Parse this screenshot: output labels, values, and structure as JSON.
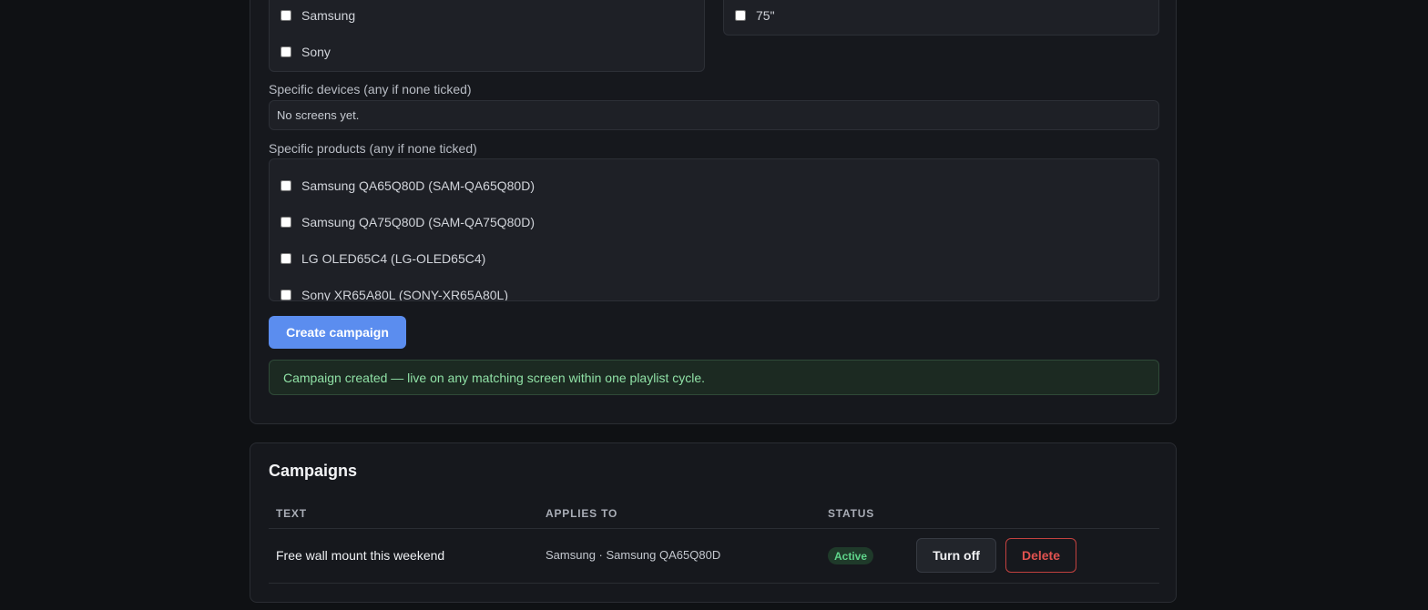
{
  "brands": {
    "items": [
      {
        "label": "Samsung",
        "checked": false
      },
      {
        "label": "Sony",
        "checked": false
      }
    ]
  },
  "sizes": {
    "items": [
      {
        "label": "75\"",
        "checked": false
      }
    ]
  },
  "devices": {
    "label": "Specific devices (any if none ticked)",
    "empty_text": "No screens yet."
  },
  "products": {
    "label": "Specific products (any if none ticked)",
    "items": [
      {
        "label": "Samsung QA65Q80D (SAM-QA65Q80D)",
        "checked": false
      },
      {
        "label": "Samsung QA75Q80D (SAM-QA75Q80D)",
        "checked": false
      },
      {
        "label": "LG OLED65C4 (LG-OLED65C4)",
        "checked": false
      },
      {
        "label": "Sony XR65A80L (SONY-XR65A80L)",
        "checked": false
      }
    ]
  },
  "form": {
    "submit_label": "Create campaign",
    "success_message": "Campaign created — live on any matching screen within one playlist cycle."
  },
  "campaigns": {
    "title": "Campaigns",
    "columns": [
      "TEXT",
      "APPLIES TO",
      "STATUS"
    ],
    "rows": [
      {
        "text": "Free wall mount this weekend",
        "applies_to": "Samsung · Samsung QA65Q80D",
        "status": "Active",
        "turn_off_label": "Turn off",
        "delete_label": "Delete"
      }
    ]
  },
  "colors": {
    "background": "#0f1114",
    "accent": "#5b8def",
    "success": "#5fd48a",
    "danger": "#e0524f"
  }
}
